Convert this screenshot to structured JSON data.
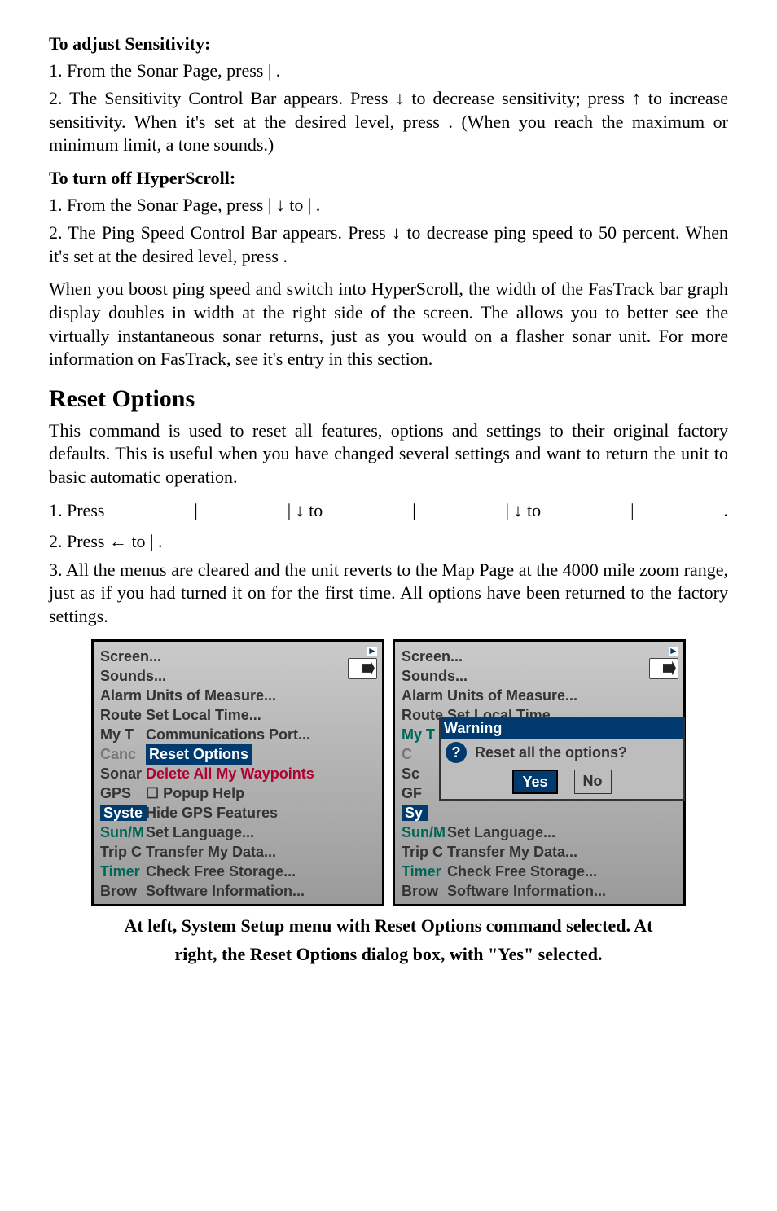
{
  "h1": "To adjust Sensitivity:",
  "s1_1_a": "1. From the Sonar Page, press ",
  "s1_1_b": " | ",
  "s1_1_c": ".",
  "s1_2_a": "2. The Sensitivity Control Bar appears. Press ↓ to decrease sensitivity; press ↑ to increase sensitivity. When it's set at the desired level, press ",
  "s1_2_b": ". (When you reach the maximum or minimum limit, a tone sounds.)",
  "h2": "To turn off HyperScroll:",
  "s2_1_a": "1. From the Sonar Page, press ",
  "s2_1_b": " | ↓ to ",
  "s2_1_c": " | ",
  "s2_1_d": ".",
  "s2_2_a": "2. The Ping Speed Control Bar appears. Press ↓ to decrease ping speed to 50 percent. When it's set at the desired level, press ",
  "s2_2_b": ".",
  "para3": "When you boost ping speed and switch into HyperScroll, the width of the FasTrack bar graph display doubles in width at the right side of the screen. The allows you to better see the virtually instantaneous sonar returns, just as you would on a flasher sonar unit. For more information on FasTrack, see it's entry in this section.",
  "h3": "Reset Options",
  "para4": "This command is used to reset all features, options and settings to their original factory defaults. This is useful when you have changed several settings and want to return the unit to basic automatic operation.",
  "s3_1_a": "1. Press ",
  "s3_1_b": " | ",
  "s3_1_c": " | ↓ to ",
  "s3_1_d": " | ",
  "s3_1_e": " | ↓ to ",
  "s3_1_f": " | ",
  "s3_1_g": ".",
  "s3_2_a": "2. Press ← to ",
  "s3_2_b": " | ",
  "s3_2_c": ".",
  "s3_3": "3. All the menus are cleared and the unit reverts to the Map Page at the 4000 mile zoom range, just as if you had turned it on for the first time. All options have been returned to the factory settings.",
  "fig_left": {
    "left_col": [
      "Screen...",
      "Sounds...",
      "Alarm",
      "Route",
      "My T",
      "Canc",
      "Sonar",
      "GPS",
      "Syste",
      "Sun/M",
      "Trip C",
      "Timer",
      "Brow"
    ],
    "sub": [
      "Units of Measure...",
      "Set Local Time...",
      "Communications Port...",
      "Reset Options",
      "Delete All My Waypoints",
      "Popup Help",
      "Hide GPS Features",
      "Set Language...",
      "Transfer My Data...",
      "Check Free Storage...",
      "Software Information..."
    ]
  },
  "fig_right": {
    "left_col": [
      "Screen...",
      "Sounds...",
      "Alarm",
      "Route",
      "My T",
      "C",
      "Sc",
      "GF",
      "Sy",
      "Sun/M",
      "Trip C",
      "Timer",
      "Brow"
    ],
    "sub_top": [
      "Units of Measure...",
      "Set Local Time..."
    ],
    "modal": {
      "title": "Warning",
      "text": "Reset all the options?",
      "yes": "Yes",
      "no": "No"
    },
    "sub_bottom": [
      "Set Language...",
      "Transfer My Data...",
      "Check Free Storage...",
      "Software Information..."
    ]
  },
  "caption1": "At left, System Setup menu with Reset Options command selected. At",
  "caption2": "right, the Reset Options dialog box, with \"Yes\" selected."
}
